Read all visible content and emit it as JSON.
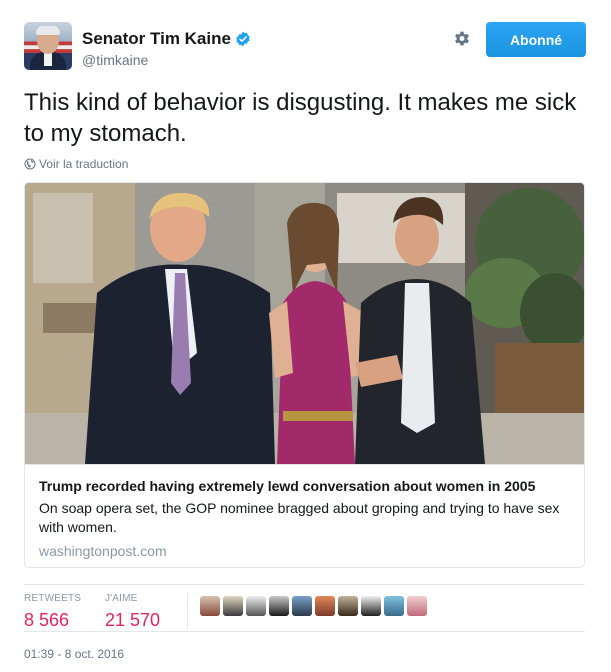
{
  "author": {
    "display_name": "Senator Tim Kaine",
    "handle": "@timkaine",
    "verified_icon": "verified-badge-icon",
    "avatar_icon": "profile-avatar"
  },
  "actions": {
    "settings_icon": "gear-icon",
    "follow_label": "Abonné",
    "follow_color": "#1da1f2"
  },
  "tweet": {
    "text": "This kind of behavior is disgusting. It makes me sick to my stomach.",
    "translate_label": "Voir la traduction",
    "translate_icon": "globe-icon"
  },
  "card": {
    "title": "Trump recorded having extremely lewd conversation about women in 2005",
    "description": "On soap opera set, the GOP nominee bragged about groping and trying to have sex with women.",
    "domain": "washingtonpost.com"
  },
  "stats": {
    "retweets_label": "RETWEETS",
    "retweets_value": "8 566",
    "likes_label": "J'AIME",
    "likes_value": "21 570",
    "value_color": "#e0245e",
    "liker_avatar_count": 10
  },
  "timestamp": "01:39 - 8 oct. 2016"
}
